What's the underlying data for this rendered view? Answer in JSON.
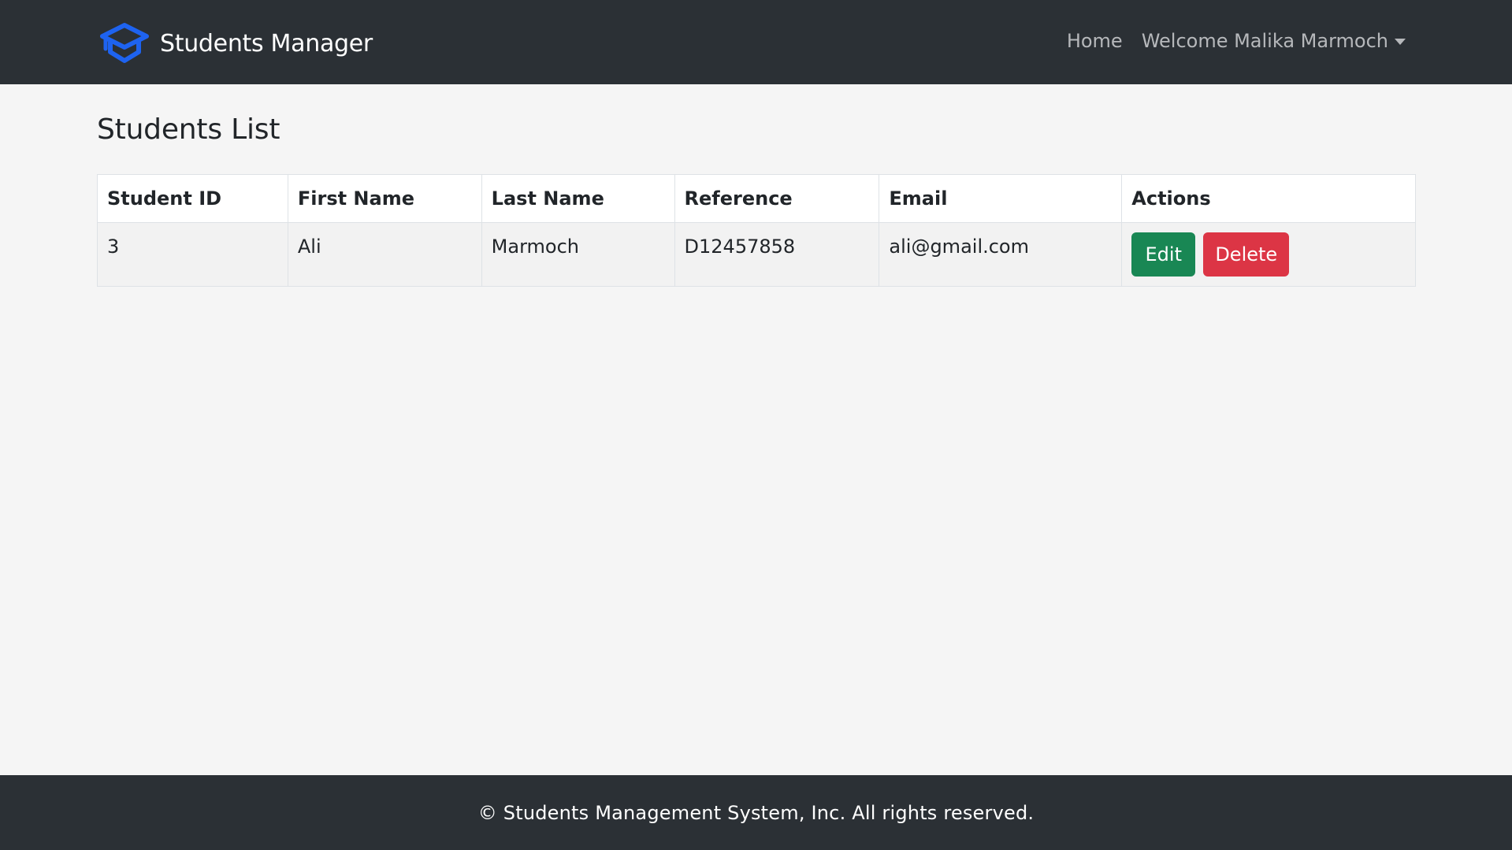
{
  "navbar": {
    "brand_text": "Students Manager",
    "brand_icon": "graduation-cap-icon",
    "brand_color": "#1e63f0",
    "home_label": "Home",
    "user_menu_label": "Welcome Malika Marmoch"
  },
  "main": {
    "title": "Students List",
    "table": {
      "headers": [
        "Student ID",
        "First Name",
        "Last Name",
        "Reference",
        "Email",
        "Actions"
      ],
      "rows": [
        {
          "id": "3",
          "first_name": "Ali",
          "last_name": "Marmoch",
          "reference": "D12457858",
          "email": "ali@gmail.com",
          "edit_label": "Edit",
          "delete_label": "Delete"
        }
      ]
    }
  },
  "footer": {
    "text": "© Students Management System, Inc. All rights reserved."
  },
  "colors": {
    "navbar_bg": "#2b3035",
    "page_bg": "#f5f5f5",
    "edit_button": "#198754",
    "delete_button": "#dc3545"
  }
}
